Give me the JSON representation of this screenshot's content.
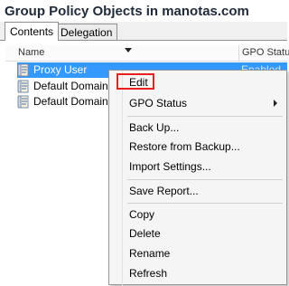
{
  "title": "Group Policy Objects in manotas.com",
  "tabs": [
    {
      "label": "Contents"
    },
    {
      "label": "Delegation"
    }
  ],
  "columns": {
    "name": "Name",
    "status": "GPO Status"
  },
  "rows": [
    {
      "name": "Proxy User",
      "status": "Enabled",
      "selected": true
    },
    {
      "name": "Default Domain",
      "status": ""
    },
    {
      "name": "Default Domain",
      "status": ""
    }
  ],
  "context_menu": {
    "items": [
      {
        "label": "Edit",
        "highlighted": true
      },
      {
        "label": "GPO Status",
        "submenu": true
      },
      {
        "label": "Back Up..."
      },
      {
        "label": "Restore from Backup..."
      },
      {
        "label": "Import Settings..."
      },
      {
        "label": "Save Report..."
      },
      {
        "label": "Copy"
      },
      {
        "label": "Delete"
      },
      {
        "label": "Rename"
      },
      {
        "label": "Refresh"
      }
    ]
  },
  "colors": {
    "selection": "#3399ff",
    "highlight_box": "#e5201d",
    "title": "#1e2a3a"
  },
  "icons": {
    "row_icon": "gpo-scroll-icon",
    "submenu_icon": "chevron-right-icon",
    "sort_icon": "sort-down-icon"
  }
}
